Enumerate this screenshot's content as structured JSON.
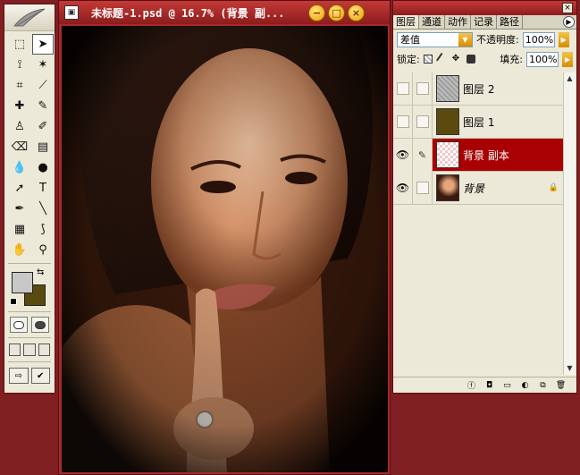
{
  "document": {
    "title": "未标题-1.psd @ 16.7% (背景 副...",
    "buttons": {
      "minimize": "−",
      "restore": "□",
      "close": "×"
    }
  },
  "toolbox": {
    "tools": [
      {
        "name": "marquee-tool",
        "glyph": "⬚"
      },
      {
        "name": "move-tool",
        "glyph": "➤",
        "active": true
      },
      {
        "name": "lasso-tool",
        "glyph": "⟟"
      },
      {
        "name": "magic-wand-tool",
        "glyph": "✶"
      },
      {
        "name": "crop-tool",
        "glyph": "⌗"
      },
      {
        "name": "slice-tool",
        "glyph": "⟋"
      },
      {
        "name": "healing-brush-tool",
        "glyph": "✚"
      },
      {
        "name": "brush-tool",
        "glyph": "✎"
      },
      {
        "name": "clone-stamp-tool",
        "glyph": "♙"
      },
      {
        "name": "history-brush-tool",
        "glyph": "✐"
      },
      {
        "name": "eraser-tool",
        "glyph": "⌫"
      },
      {
        "name": "gradient-tool",
        "glyph": "▤"
      },
      {
        "name": "blur-tool",
        "glyph": "💧"
      },
      {
        "name": "dodge-tool",
        "glyph": "●"
      },
      {
        "name": "path-selection-tool",
        "glyph": "➚"
      },
      {
        "name": "type-tool",
        "glyph": "T"
      },
      {
        "name": "pen-tool",
        "glyph": "✒"
      },
      {
        "name": "line-tool",
        "glyph": "╲"
      },
      {
        "name": "notes-tool",
        "glyph": "▦"
      },
      {
        "name": "eyedropper-tool",
        "glyph": "⟆"
      },
      {
        "name": "hand-tool",
        "glyph": "✋"
      },
      {
        "name": "zoom-tool",
        "glyph": "⚲"
      }
    ]
  },
  "layers_panel": {
    "tabs": [
      "图层",
      "通道",
      "动作",
      "记录",
      "路径"
    ],
    "blend_mode": "差值",
    "opacity_label": "不透明度:",
    "opacity_value": "100%",
    "lock_label": "锁定:",
    "fill_label": "填充:",
    "fill_value": "100%",
    "layers": [
      {
        "name": "图层 2",
        "thumb": "gray",
        "visible": false,
        "selected": false
      },
      {
        "name": "图层 1",
        "thumb": "olive",
        "visible": false,
        "selected": false
      },
      {
        "name": "背景 副本",
        "thumb": "transparent",
        "visible": true,
        "selected": true
      },
      {
        "name": "背景",
        "thumb": "photo",
        "visible": true,
        "selected": false,
        "locked": true
      }
    ]
  },
  "colors": {
    "foreground": "#c8c8c8",
    "background": "#5a4a10",
    "selection": "#a90103",
    "window_frame": "#7f1f22"
  }
}
